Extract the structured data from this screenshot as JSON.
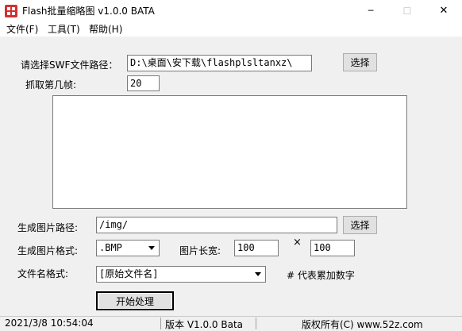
{
  "window": {
    "title": "Flash批量缩略图 v1.0.0 BATA",
    "minimize_glyph": "─",
    "maximize_glyph": "☐",
    "close_glyph": "✕"
  },
  "menu": [
    "文件(F)",
    "工具(T)",
    "帮助(H)"
  ],
  "form": {
    "swf_path_label": "请选择SWF文件路径：",
    "swf_path_value": "D:\\桌面\\安下载\\flashplsltanxz\\",
    "swf_browse_label": "选择",
    "frame_label": "抓取第几帧:",
    "frame_value": "20",
    "output_path_label": "生成图片路径:",
    "output_path_value": "/img/",
    "output_browse_label": "选择",
    "format_label": "生成图片格式:",
    "format_value": ".BMP",
    "size_label": "图片长宽:",
    "width_value": "100",
    "times_sign": "×",
    "height_value": "100",
    "filename_label": "文件名格式:",
    "filename_value": "[原始文件名]",
    "filename_hint": "# 代表累加数字",
    "start_button_label": "开始处理"
  },
  "status": {
    "datetime": "2021/3/8 10:54:04",
    "version": "版本 V1.0.0 Bata",
    "copyright": "版权所有(C) www.52z.com"
  },
  "colors": {
    "accent_icon": "#d32f2f"
  },
  "icons": {
    "app": "flash-app-icon",
    "combo": "chevron-down-icon"
  }
}
